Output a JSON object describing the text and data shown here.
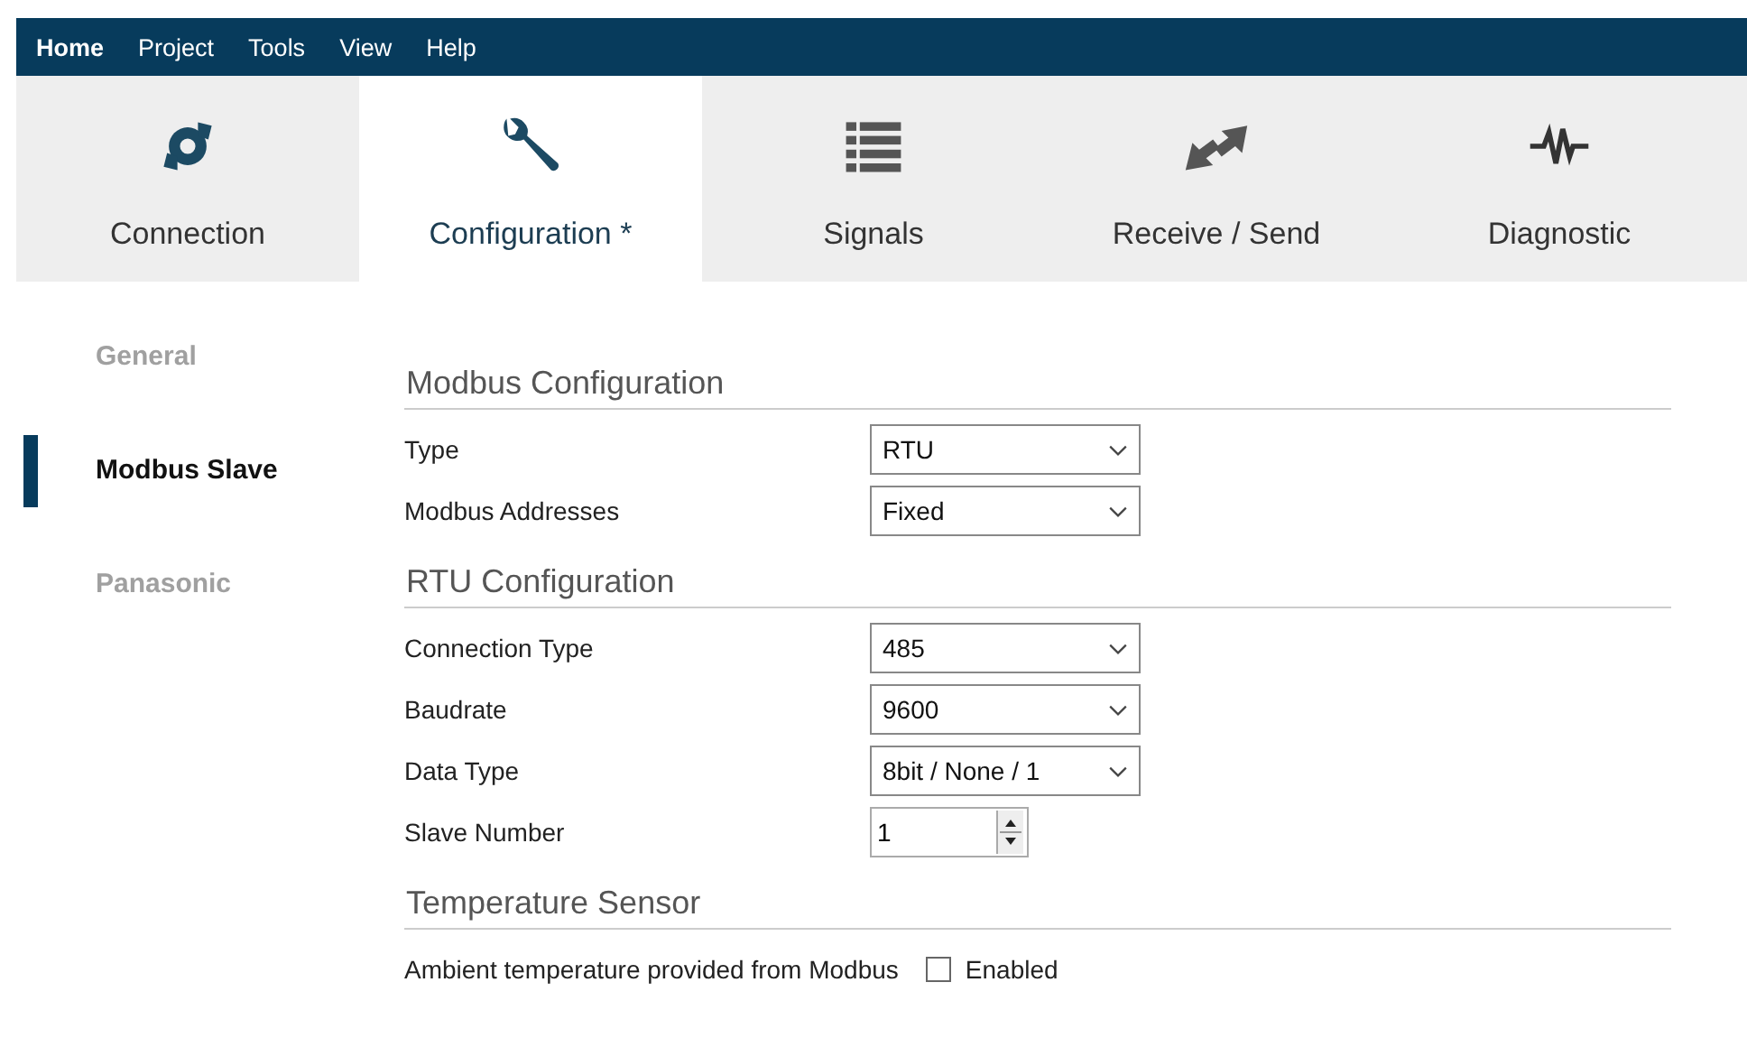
{
  "menu": [
    {
      "label": "Home",
      "selected": true
    },
    {
      "label": "Project",
      "selected": false
    },
    {
      "label": "Tools",
      "selected": false
    },
    {
      "label": "View",
      "selected": false
    },
    {
      "label": "Help",
      "selected": false
    }
  ],
  "tabs": [
    {
      "label": "Connection",
      "kind": "plug",
      "selected": false
    },
    {
      "label": "Configuration *",
      "kind": "wrench",
      "selected": true
    },
    {
      "label": "Signals",
      "kind": "list",
      "selected": false
    },
    {
      "label": "Receive / Send",
      "kind": "arrows",
      "selected": false
    },
    {
      "label": "Diagnostic",
      "kind": "wave",
      "selected": false
    }
  ],
  "sidebar": {
    "items": [
      {
        "label": "General",
        "selected": false
      },
      {
        "label": "Modbus Slave",
        "selected": true
      },
      {
        "label": "Panasonic",
        "selected": false
      }
    ]
  },
  "sections": [
    {
      "title": "Modbus Configuration",
      "rows": [
        {
          "kind": "dropdown",
          "label": "Type",
          "value": "RTU"
        },
        {
          "kind": "dropdown",
          "label": "Modbus Addresses",
          "value": "Fixed"
        }
      ]
    },
    {
      "title": "RTU Configuration",
      "rows": [
        {
          "kind": "dropdown",
          "label": "Connection Type",
          "value": "485"
        },
        {
          "kind": "dropdown",
          "label": "Baudrate",
          "value": "9600"
        },
        {
          "kind": "dropdown",
          "label": "Data Type",
          "value": "8bit / None / 1"
        },
        {
          "kind": "spinner",
          "label": "Slave Number",
          "value": "1"
        }
      ]
    },
    {
      "title": "Temperature Sensor",
      "rows": [
        {
          "kind": "checkbox",
          "label": "Ambient temperature provided from Modbus",
          "text": "Enabled",
          "checked": false
        }
      ]
    }
  ]
}
